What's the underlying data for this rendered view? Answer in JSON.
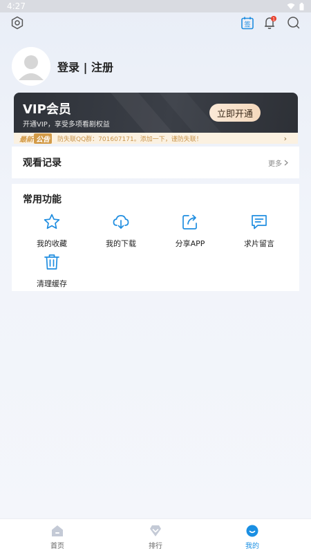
{
  "status_bar": {
    "time": "4:27"
  },
  "profile": {
    "login_label": "登录 | 注册"
  },
  "vip": {
    "title": "VIP会员",
    "subtitle": "开通VIP，享受多项看剧权益",
    "button_label": "立即开通"
  },
  "notice": {
    "tag_part1": "最新",
    "tag_part2": "公告",
    "text": "防失联QQ群：701607171。添加一下，谨防失联！"
  },
  "history": {
    "title": "观看记录",
    "more_label": "更多"
  },
  "functions": {
    "title": "常用功能",
    "items": [
      {
        "label": "我的收藏",
        "icon": "star-icon"
      },
      {
        "label": "我的下载",
        "icon": "cloud-download-icon"
      },
      {
        "label": "分享APP",
        "icon": "share-icon"
      },
      {
        "label": "求片留言",
        "icon": "message-icon"
      },
      {
        "label": "清理缓存",
        "icon": "trash-icon"
      }
    ]
  },
  "bottom_nav": {
    "items": [
      {
        "label": "首页",
        "icon": "home-icon"
      },
      {
        "label": "排行",
        "icon": "ranking-icon"
      },
      {
        "label": "我的",
        "icon": "profile-icon",
        "active": true
      }
    ]
  },
  "colors": {
    "accent": "#1a8fe3",
    "icon_blue": "#1f8de0",
    "vip_dark": "#33373e",
    "vip_button": "#f7dfc6",
    "notice_text": "#c9954c",
    "badge_red": "#e8412f"
  },
  "calendar_icon_text": "签",
  "notification_badge": "1"
}
